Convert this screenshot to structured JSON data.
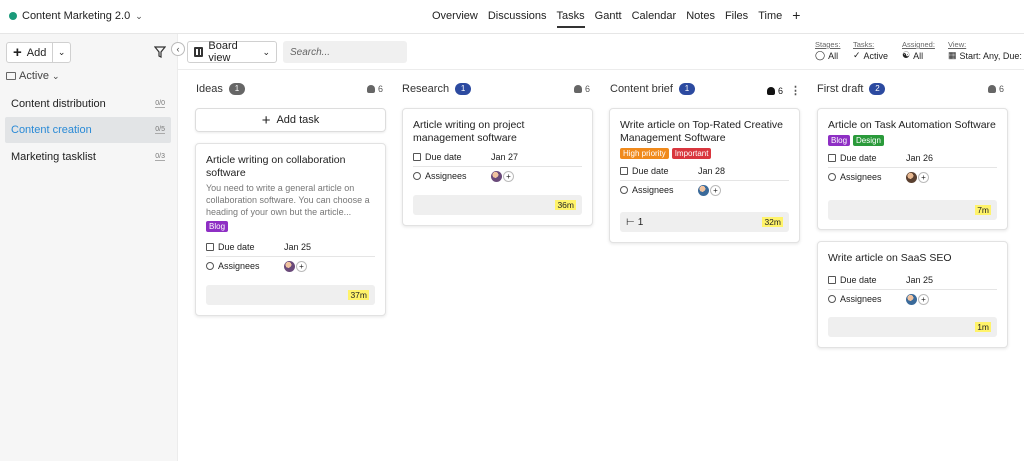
{
  "header": {
    "project_name": "Content Marketing 2.0",
    "nav": [
      "Overview",
      "Discussions",
      "Tasks",
      "Gantt",
      "Calendar",
      "Notes",
      "Files",
      "Time"
    ],
    "active_tab": "Tasks"
  },
  "sidebar": {
    "add_label": "Add",
    "filter_label": "Active",
    "items": [
      {
        "label": "Content distribution",
        "count": "0/0"
      },
      {
        "label": "Content creation",
        "count": "0/5"
      },
      {
        "label": "Marketing tasklist",
        "count": "0/3"
      }
    ]
  },
  "toolbar": {
    "view_label": "Board view",
    "search_placeholder": "Search...",
    "filters": [
      {
        "label": "Stages:",
        "value": "All"
      },
      {
        "label": "Tasks:",
        "value": "Active"
      },
      {
        "label": "Assigned:",
        "value": "All"
      },
      {
        "label": "View:",
        "value": "Start: Any, Due:"
      }
    ]
  },
  "board": {
    "add_task_label": "Add task",
    "columns": [
      {
        "name": "Ideas",
        "count": "1",
        "users": "6",
        "cards": [
          {
            "title": "Article writing on collaboration software",
            "description": "You need to write a general article on collaboration software. You can choose a heading of your own but the article...",
            "tags": [
              {
                "label": "Blog",
                "color": "#8e2fc4"
              }
            ],
            "due_label": "Due date",
            "due": "Jan 25",
            "assignees_label": "Assignees",
            "time": "37m"
          }
        ]
      },
      {
        "name": "Research",
        "count": "1",
        "users": "6",
        "cards": [
          {
            "title": "Article writing on project management software",
            "tags": [],
            "due_label": "Due date",
            "due": "Jan 27",
            "assignees_label": "Assignees",
            "time": "36m"
          }
        ]
      },
      {
        "name": "Content brief",
        "count": "1",
        "users": "6",
        "cards": [
          {
            "title": "Write article on Top-Rated Creative Management Software",
            "tags": [
              {
                "label": "High priority",
                "color": "#f08a1c"
              },
              {
                "label": "Important",
                "color": "#d9363e"
              }
            ],
            "due_label": "Due date",
            "due": "Jan 28",
            "assignees_label": "Assignees",
            "subtasks": "1",
            "time": "32m"
          }
        ]
      },
      {
        "name": "First draft",
        "count": "2",
        "users": "6",
        "cards": [
          {
            "title": "Article on Task Automation Software",
            "tags": [
              {
                "label": "Blog",
                "color": "#8e2fc4"
              },
              {
                "label": "Design",
                "color": "#2a9a3a"
              }
            ],
            "due_label": "Due date",
            "due": "Jan 26",
            "assignees_label": "Assignees",
            "time": "7m"
          },
          {
            "title": "Write article on SaaS SEO",
            "tags": [],
            "due_label": "Due date",
            "due": "Jan 25",
            "assignees_label": "Assignees",
            "time": "1m"
          }
        ]
      }
    ]
  },
  "colors": {
    "accent": "#2a8ad6",
    "badge_blue": "#2c4aa0",
    "project_dot": "#1a9a7a",
    "time_highlight": "#fff36a"
  }
}
